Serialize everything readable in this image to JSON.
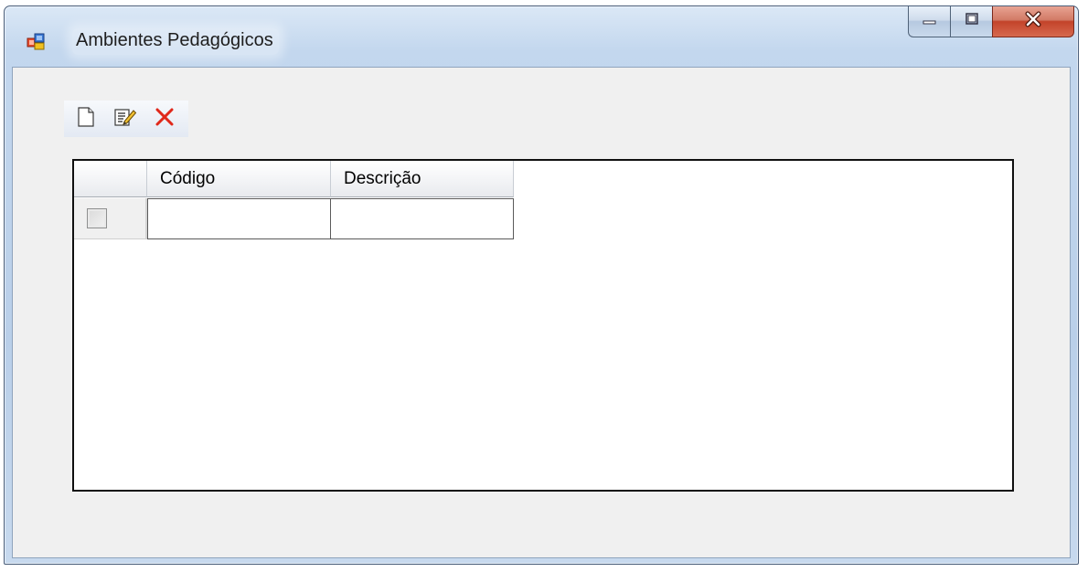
{
  "window": {
    "title": "Ambientes Pedagógicos",
    "icon": "app-form-icon",
    "controls": {
      "minimize_icon": "minimize-icon",
      "maximize_icon": "maximize-icon",
      "close_icon": "close-icon"
    }
  },
  "toolbar": {
    "buttons": [
      {
        "name": "new",
        "icon": "new-document-icon"
      },
      {
        "name": "edit",
        "icon": "edit-document-icon"
      },
      {
        "name": "delete",
        "icon": "delete-x-icon"
      }
    ]
  },
  "grid": {
    "columns": [
      "Código",
      "Descrição"
    ],
    "rows": [
      {
        "selected": false,
        "codigo": "",
        "descricao": ""
      }
    ]
  },
  "colors": {
    "delete_icon": "#e0281a",
    "grid_border": "#101010",
    "client_background": "#f0f0f0"
  }
}
